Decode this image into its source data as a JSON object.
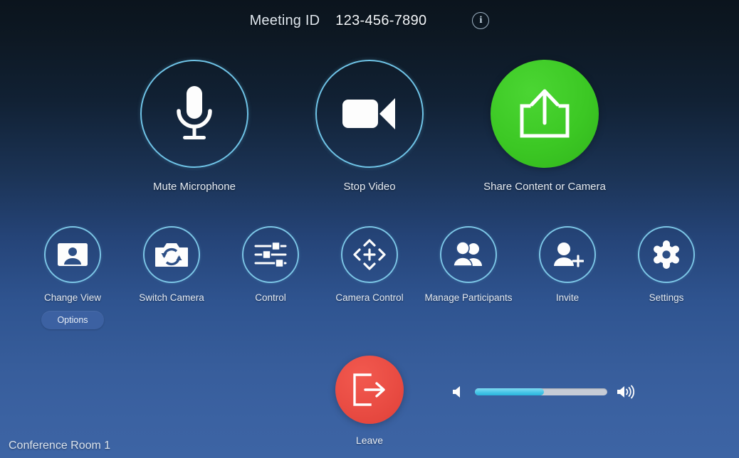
{
  "header": {
    "meeting_id_label": "Meeting ID",
    "meeting_id_value": "123-456-7890",
    "info_glyph": "i",
    "info_icon_name": "info-icon"
  },
  "primary_controls": [
    {
      "label": "Mute Microphone",
      "icon": "microphone-icon",
      "style": "outline"
    },
    {
      "label": "Stop Video",
      "icon": "video-camera-icon",
      "style": "outline"
    },
    {
      "label": "Share Content or Camera",
      "icon": "share-upload-icon",
      "style": "filled-green"
    }
  ],
  "secondary_controls": [
    {
      "label": "Change View",
      "icon": "person-card-icon",
      "sub_button": "Options"
    },
    {
      "label": "Switch Camera",
      "icon": "camera-switch-icon"
    },
    {
      "label": "Control",
      "icon": "sliders-icon"
    },
    {
      "label": "Camera Control",
      "icon": "dpad-icon"
    },
    {
      "label": "Manage Participants",
      "icon": "people-icon"
    },
    {
      "label": "Invite",
      "icon": "person-add-icon"
    },
    {
      "label": "Settings",
      "icon": "gear-icon"
    }
  ],
  "leave": {
    "label": "Leave",
    "icon": "exit-door-icon"
  },
  "volume": {
    "level_percent": 52,
    "low_icon": "speaker-mute-icon",
    "high_icon": "speaker-waves-icon"
  },
  "footer": {
    "room_name": "Conference Room 1"
  },
  "colors": {
    "accent_green": "#3cc824",
    "accent_red": "#e94c43",
    "outline_blue": "#7cc6e6",
    "slider_fill": "#45c4e6",
    "slider_track": "#c6ccd6",
    "pill_blue": "#3c61a2"
  }
}
